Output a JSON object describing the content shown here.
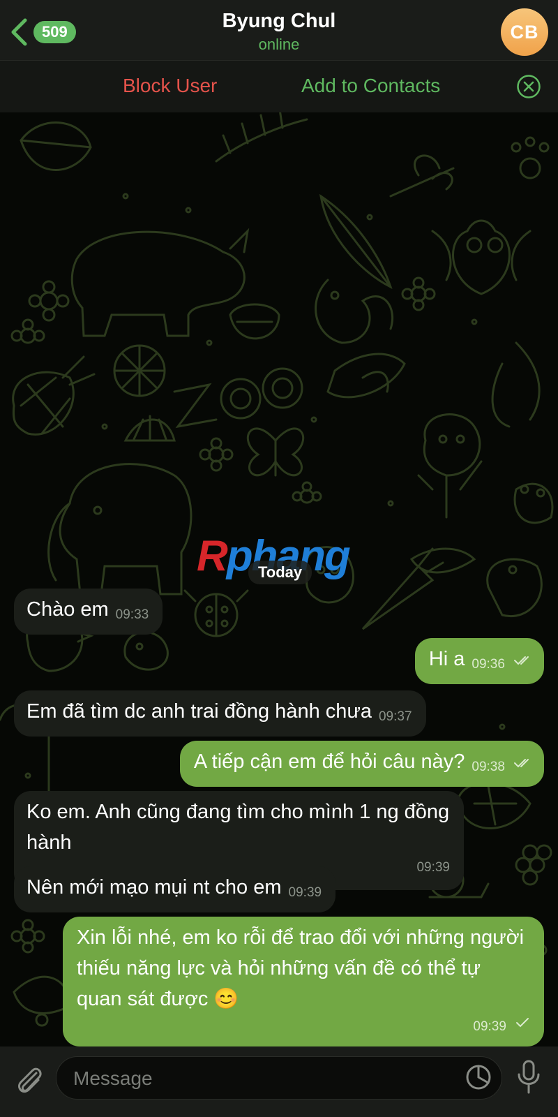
{
  "header": {
    "back_count": "509",
    "title": "Byung Chul",
    "status": "online",
    "avatar_initials": "CB"
  },
  "actions": {
    "block_label": "Block User",
    "add_label": "Add to Contacts"
  },
  "chat": {
    "watermark_r": "R",
    "watermark_rest": "phang",
    "date_label": "Today",
    "messages": [
      {
        "dir": "in",
        "text": "Chào em",
        "time": "09:33"
      },
      {
        "dir": "out",
        "text": "Hi a",
        "time": "09:36",
        "read": true
      },
      {
        "dir": "in",
        "text": "Em đã tìm dc anh trai đồng hành chưa",
        "time": "09:37"
      },
      {
        "dir": "out",
        "text": "A tiếp cận em để hỏi câu này?",
        "time": "09:38",
        "read": true
      },
      {
        "dir": "in",
        "text": "Ko em. Anh cũng đang tìm cho mình 1 ng đồng hành",
        "time": "09:39"
      },
      {
        "dir": "in",
        "text": "Nên mới mạo mụi nt cho em",
        "time": "09:39"
      },
      {
        "dir": "out",
        "text": "Xin lỗi nhé, em ko rỗi để trao đổi với những người thiếu năng lực và hỏi những vấn đề có thể tự quan sát được 😊",
        "time": "09:39",
        "read": false
      }
    ]
  },
  "input": {
    "placeholder": "Message"
  },
  "colors": {
    "accent": "#5fb960",
    "danger": "#e5534b",
    "outgoing_bubble": "#72a844",
    "incoming_bubble": "#1b1e19"
  },
  "icons": [
    "chevron-left-icon",
    "close-circle-icon",
    "paperclip-icon",
    "sticker-icon",
    "microphone-icon",
    "double-check-icon",
    "check-icon"
  ]
}
